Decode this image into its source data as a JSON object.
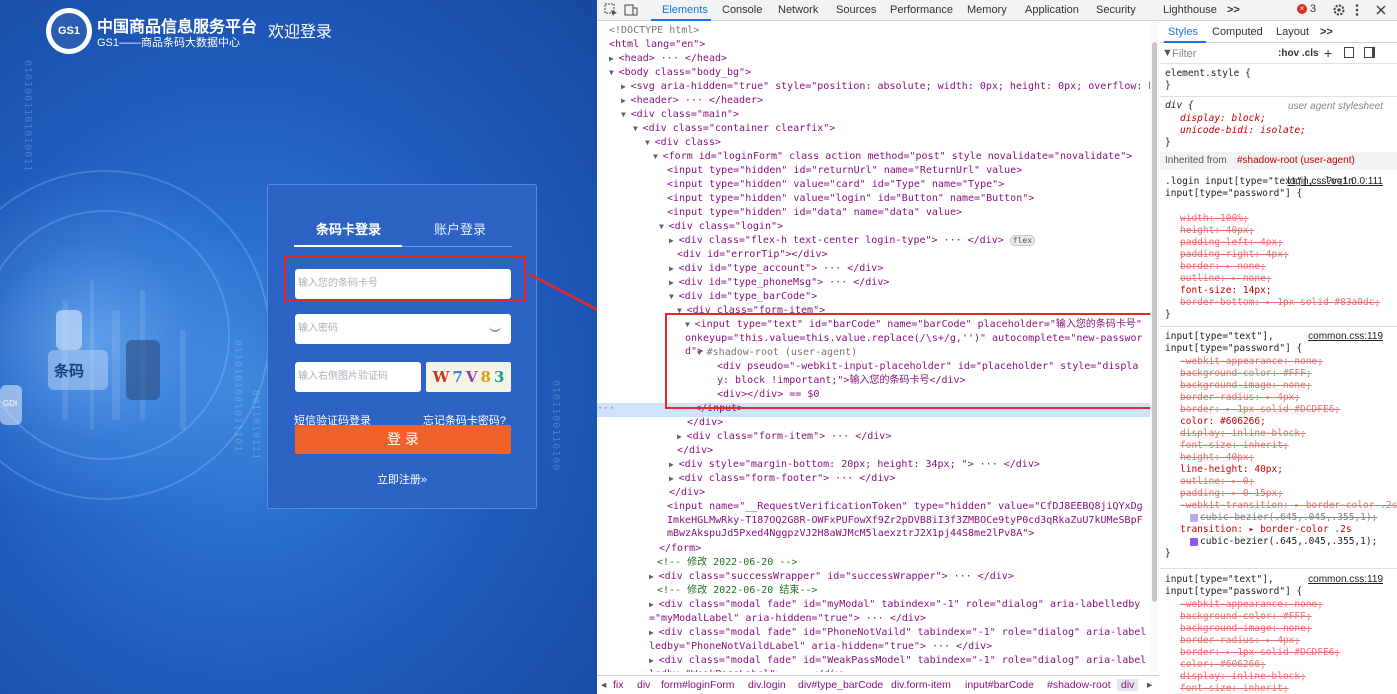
{
  "site": {
    "brand_title": "中国商品信息服务平台",
    "brand_sub": "GS1——商品条码大数据中心",
    "logo_text": "GS1",
    "welcome": "欢迎登录",
    "tabs": [
      "条码卡登录",
      "账户登录"
    ],
    "card_placeholder": "输入您的条码卡号",
    "pwd_placeholder": "输入密码",
    "captcha_placeholder": "输入右侧图片验证码",
    "captcha_chars": [
      "W",
      "7",
      "V",
      "8",
      "3"
    ],
    "sms_link": "短信验证码登录",
    "forgot_link": "忘记条码卡密码?",
    "login_button": "登 录",
    "register_link": "立即注册»",
    "deco_barcode": "条码",
    "deco_gdi": "GDI",
    "colors": {
      "login_button": "#f0622b",
      "highlight_box": "#e8262a",
      "panel": "#2d63c4"
    }
  },
  "devtools": {
    "tabs": [
      "Elements",
      "Console",
      "Network",
      "Sources",
      "Performance",
      "Memory",
      "Application",
      "Security",
      "Lighthouse",
      ">>"
    ],
    "error_count": "3",
    "breadcrumb": [
      "fix",
      "div",
      "form#loginForm",
      "div.login",
      "div#type_barCode",
      "div.form-item",
      "input#barCode",
      "#shadow-root",
      "div"
    ],
    "styles_tabs": [
      "Styles",
      "Computed",
      "Layout",
      ">>"
    ],
    "filter_placeholder": "Filter",
    "filter_buttons": ":hov .cls",
    "element_style": "element.style {",
    "inherited_from_label": "Inherited from ",
    "inherited_from_target": "#shadow-root (user-agent)",
    "sources": [
      "user agent stylesheet",
      "login.css?v=1.0.0:111",
      "common.css:119",
      "common.css:119"
    ],
    "dom_lines": [
      "<!DOCTYPE html>",
      "<html lang=\"en\">",
      "<head> ··· </head>",
      "<body class=\"body_bg\">",
      "<svg aria-hidden=\"true\" style=\"position: absolute; width: 0px; height: 0px; overflow: hidden;\"> ··· </svg>",
      "<header> ··· </header>",
      "<div class=\"main\">",
      "<div class=\"container clearfix\">",
      "<div class>",
      "<form id=\"loginForm\" class action method=\"post\" style novalidate=\"novalidate\">",
      "<input type=\"hidden\" id=\"returnUrl\" name=\"ReturnUrl\" value>",
      "<input type=\"hidden\" value=\"card\" id=\"Type\" name=\"Type\">",
      "<input type=\"hidden\" value=\"login\" id=\"Button\" name=\"Button\">",
      "<input type=\"hidden\" id=\"data\" name=\"data\" value>",
      "<div class=\"login\">",
      "<div class=\"flex-h text-center login-type\"> ··· </div>",
      "<div id=\"errorTip\"></div>",
      "<div id=\"type_account\"> ··· </div>",
      "<div id=\"type_phoneMsg\"> ··· </div>",
      "<div id=\"type_barCode\">",
      "<div class=\"form-item\">",
      "<input type=\"text\" id=\"barCode\" name=\"barCode\" placeholder=\"输入您的条码卡号\" onkeyup=\"this.value=this.value.replace(/\\s+/g,'')\" autocomplete=\"new-password\">",
      "#shadow-root (user-agent)",
      "<div pseudo=\"-webkit-input-placeholder\" id=\"placeholder\" style=\"display: block !important;\">输入您的条码卡号</div>",
      "<div></div> == $0",
      "</input>",
      "</div>",
      "<div class=\"form-item\"> ··· </div>",
      "</div>",
      "<div style=\"margin-bottom: 20px; height: 34px; \"> ··· </div>",
      "<div class=\"form-footer\"> ··· </div>",
      "</div>",
      "<input name=\"__RequestVerificationToken\" type=\"hidden\" value=\"CfDJ8EEBQ8jiQYxDgImkeHGLMwRky-T187OQ2G8R-OWFxPUFowXf9Zr2pDVB8iI3f3ZMBOCe9tyP0cd3qRkaZuU7kUMeSBpFmBwzAkspuJd5Pxed4NggpzVJ2H8aWJMcM5laexztrJ2X1pj44S8me2lPv8A\">",
      "</form>",
      "<!-- 修改 2022-06-20 -->",
      "<div class=\"successWrapper\" id=\"successWrapper\"> ··· </div>",
      "<!-- 修改 2022-06-20 结束-->",
      "<div class=\"modal fade\" id=\"myModal\" tabindex=\"-1\" role=\"dialog\" aria-labelledby=\"myModalLabel\" aria-hidden=\"true\"> ··· </div>",
      "<div class=\"modal fade\" id=\"PhoneNotVaild\" tabindex=\"-1\" role=\"dialog\" aria-labelledby=\"PhoneNotVaildLabel\" aria-hidden=\"true\"> ··· </div>",
      "<div class=\"modal fade\" id=\"WeakPassModel\" tabindex=\"-1\" role=\"dialog\" aria-labelledby=\"WeakPassLabel\"> ··· </div>"
    ],
    "flex_chip": "flex",
    "style_rules": [
      "div {",
      "display: block;",
      "unicode-bidi: isolate;",
      ".login input[type=\"text\"], .login input[type=\"password\"] {",
      "width: 100%;",
      "height: 40px;",
      "padding-left: 4px;",
      "padding-right: 4px;",
      "border: ▸ none;",
      "outline: ▸ none;",
      "font-size: 14px;",
      "border-bottom: ▸ 1px solid #83a0dc;",
      "input[type=\"text\"], input[type=\"password\"] {",
      "-webkit-appearance: none;",
      "background-color: #FFF;",
      "background-image: none;",
      "border-radius: ▸ 4px;",
      "border: ▸ 1px solid #DCDFE6;",
      "color: #606266;",
      "display: inline-block;",
      "font-size: inherit;",
      "height: 40px;",
      "line-height: 40px;",
      "outline: ▸ 0;",
      "padding: ▸ 0 15px;",
      "-webkit-transition: ▸ border-color .2s",
      "cubic-bezier(.645,.045,.355,1);",
      "transition: ▸ border-color .2s",
      "cubic-bezier(.645,.045,.355,1);",
      "}",
      "input[type=\"text\"], input[type=\"password\"] {",
      "-webkit-appearance: none;",
      "background-color: #FFF;",
      "background-image: none;",
      "border-radius: ▸ 4px;",
      "border: ▸ 1px solid #DCDFE6;",
      "color: #606266;",
      "display: inline-block;",
      "font-size: inherit;"
    ]
  }
}
